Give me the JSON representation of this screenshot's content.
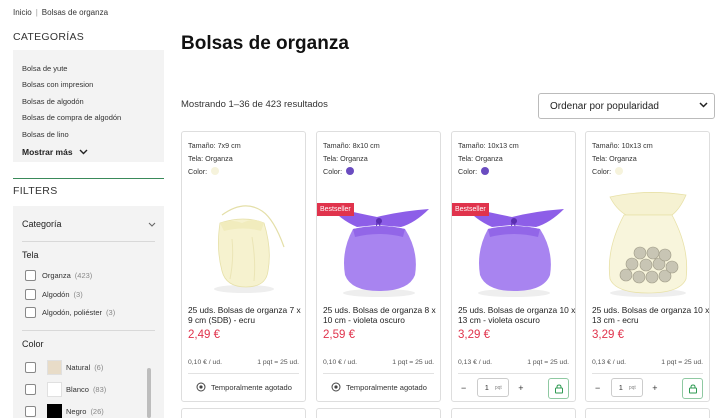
{
  "breadcrumb": {
    "home": "Inicio",
    "current": "Bolsas de organza"
  },
  "sidebar": {
    "categories_title": "CATEGORÍAS",
    "categories": [
      "Bolsa de yute",
      "Bolsas con impresion",
      "Bolsas de algodón",
      "Bolsas de compra de algodón",
      "Bolsas de lino"
    ],
    "show_more": "Mostrar más",
    "filters_title": "FILTERS",
    "category_filter": "Categoría",
    "fabric_title": "Tela",
    "fabric_options": [
      {
        "label": "Organza",
        "count": "(423)"
      },
      {
        "label": "Algodón",
        "count": "(3)"
      },
      {
        "label": "Algodón, poliéster",
        "count": "(3)"
      }
    ],
    "color_title": "Color",
    "color_options": [
      {
        "label": "Natural",
        "count": "(6)",
        "swatch": "#e8dcc8"
      },
      {
        "label": "Blanco",
        "count": "(83)",
        "swatch": "#ffffff"
      },
      {
        "label": "Negro",
        "count": "(26)",
        "swatch": "#000000"
      }
    ]
  },
  "main": {
    "title": "Bolsas de organza",
    "results": "Mostrando 1–36 de 423 resultados",
    "sort": "Ordenar por popularidad"
  },
  "products": [
    {
      "size": "Tamaño: 7x9 cm",
      "fabric": "Tela: Organza",
      "color_label": "Color:",
      "color": "#f6f3dc",
      "badge": "",
      "name": "25 uds. Bolsas de organza 7 x 9 cm (SDB) - ecru",
      "price": "2,49 €",
      "unit_price": "0,10 € / ud.",
      "pack": "1 pqt = 25 ud.",
      "stock": "Temporalmente agotado",
      "qty": "",
      "qty_unit": ""
    },
    {
      "size": "Tamaño: 8x10 cm",
      "fabric": "Tela: Organza",
      "color_label": "Color:",
      "color": "#6a4cc0",
      "badge": "Bestseller",
      "name": "25 uds. Bolsas de organza 8 x 10 cm - violeta oscuro",
      "price": "2,59 €",
      "unit_price": "0,10 € / ud.",
      "pack": "1 pqt = 25 ud.",
      "stock": "Temporalmente agotado",
      "qty": "",
      "qty_unit": ""
    },
    {
      "size": "Tamaño: 10x13 cm",
      "fabric": "Tela: Organza",
      "color_label": "Color:",
      "color": "#6a4cc0",
      "badge": "Bestseller",
      "name": "25 uds. Bolsas de organza 10 x 13 cm - violeta oscuro",
      "price": "3,29 €",
      "unit_price": "0,13 € / ud.",
      "pack": "1 pqt = 25 ud.",
      "stock": "",
      "qty": "1",
      "qty_unit": "pqt"
    },
    {
      "size": "Tamaño: 10x13 cm",
      "fabric": "Tela: Organza",
      "color_label": "Color:",
      "color": "#f6f3dc",
      "badge": "",
      "name": "25 uds. Bolsas de organza 10 x 13 cm - ecru",
      "price": "3,29 €",
      "unit_price": "0,13 € / ud.",
      "pack": "1 pqt = 25 ud.",
      "stock": "",
      "qty": "1",
      "qty_unit": "pqt"
    }
  ],
  "icons": {
    "chevron": "chevron-down-icon",
    "cart": "cart-icon",
    "unavailable": "unavailable-icon"
  }
}
